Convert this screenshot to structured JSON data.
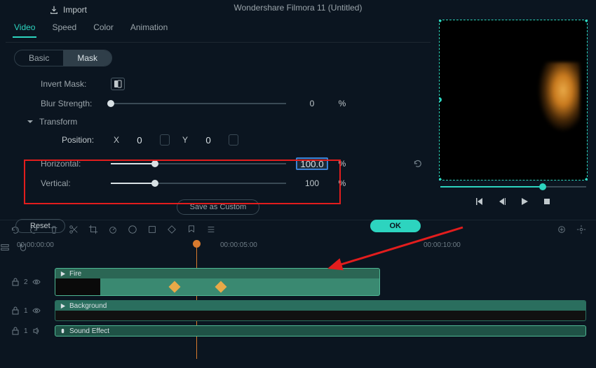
{
  "app_title": "Wondershare Filmora 11 (Untitled)",
  "import_label": "Import",
  "tabs": {
    "video": "Video",
    "speed": "Speed",
    "color": "Color",
    "animation": "Animation"
  },
  "subtabs": {
    "basic": "Basic",
    "mask": "Mask"
  },
  "mask": {
    "invert_label": "Invert Mask:",
    "blur_label": "Blur Strength:",
    "blur_value": "0",
    "blur_unit": "%",
    "transform_label": "Transform",
    "position_label": "Position:",
    "pos_x_label": "X",
    "pos_x_value": "0",
    "pos_y_label": "Y",
    "pos_y_value": "0",
    "horizontal_label": "Horizontal:",
    "horizontal_value": "100.0",
    "horizontal_unit": "%",
    "vertical_label": "Vertical:",
    "vertical_value": "100",
    "vertical_unit": "%"
  },
  "save_custom": "Save as Custom",
  "reset": "Reset",
  "ok": "OK",
  "timecodes": {
    "t0": "00:00:00:00",
    "t5": "00:00:05:00",
    "t10": "00:00:10:00"
  },
  "tracks": {
    "fire": "Fire",
    "background": "Background",
    "sound": "Sound Effect",
    "v2": "2",
    "v1": "1",
    "a1": "1"
  }
}
